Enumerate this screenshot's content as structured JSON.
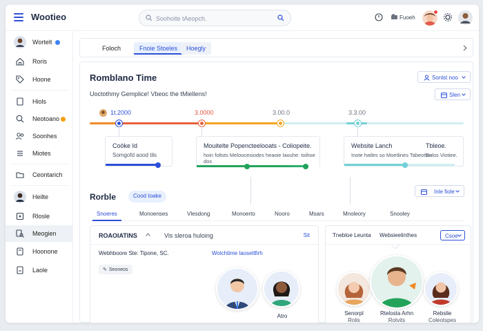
{
  "app": {
    "brand": "Wootieo"
  },
  "search": {
    "placeholder": "Soohoite tAeopch."
  },
  "topbar": {
    "status_label": "Fuoeh"
  },
  "sidebar": {
    "items": [
      {
        "label": "Wortelt",
        "icon": "avatar-icon",
        "badge_color": "#3b82f6"
      },
      {
        "label": "Roris",
        "icon": "home-icon"
      },
      {
        "label": "Hoone",
        "icon": "tag-icon"
      },
      {
        "label": "Hiols",
        "icon": "page-icon"
      },
      {
        "label": "Neotoano",
        "icon": "search-icon",
        "badge_color": "#f59e0b"
      },
      {
        "label": "Soonhes",
        "icon": "users-icon"
      },
      {
        "label": "Miotes",
        "icon": "list-icon"
      },
      {
        "label": "Ceontarich",
        "icon": "folder-icon"
      },
      {
        "label": "Heilte",
        "icon": "avatar-icon"
      },
      {
        "label": "Rlosle",
        "icon": "play-icon"
      },
      {
        "label": "Meogien",
        "icon": "search-doc-icon"
      },
      {
        "label": "Hoonone",
        "icon": "doc-icon"
      },
      {
        "label": "Laole",
        "icon": "file-icon"
      }
    ]
  },
  "tabs": [
    "Foloch",
    "Fnoie Stoeles",
    "Hoegly"
  ],
  "main": {
    "title": "Romblano Time",
    "subtitle": "Uoctothmy Gemplice! Vbeoc the tMiellens!",
    "btn_top": "Sonlst noo",
    "btn_second": "Slen",
    "btn_third": "Inle fiole"
  },
  "timeline": {
    "labels": [
      "1t.2000",
      "3.0000",
      "3.00.0",
      "3.3.00"
    ],
    "events": [
      {
        "title": "Coöke Id",
        "sub": "Somgofd aood tils"
      },
      {
        "title": "Mouitelte Popencteelooats - Coliopeite.",
        "sub": "hoin foltsts Meloocesiodes heaoie laouhe: toihoe dos"
      },
      {
        "title": "Website Lanch",
        "sub": "Inote hatles so Moetlines Tabeotlas"
      },
      {
        "title": "Tbleoe.",
        "sub": "Solos Viotiee."
      }
    ]
  },
  "roble": {
    "title": "Rorble",
    "chip": "Cood toake",
    "subtabs": [
      "Snoeres",
      "Monoenses",
      "Vlesdong",
      "Monoerto",
      "Nooro",
      "Msars",
      "Mnoleory",
      "Snooley"
    ]
  },
  "left_panel": {
    "heading": "ROAOIATINS",
    "heading_sub": "Vis sleroa huloing",
    "edit": "Sit",
    "row_left": "Webhboore Ste: Tipone, SC.",
    "row_right": "Wolchtime laoseltfirh",
    "tag": "Seoneos",
    "person_name": "Atro"
  },
  "right_panel": {
    "heading": "Tnebloe Leunta",
    "heading_sub": "Websieelinthes",
    "select": "Csoe",
    "people": [
      {
        "name": "Senorpl",
        "role": "Rolis"
      },
      {
        "name": "Rtelosta Arhn",
        "role": "Rotvits"
      },
      {
        "name": "Rebslie",
        "role": "Coleotspes"
      }
    ]
  },
  "colors": {
    "accent": "#2b4fd6",
    "orange": "#f08a24",
    "red": "#e0533b",
    "green": "#22a35a",
    "teal": "#71cfd6"
  }
}
